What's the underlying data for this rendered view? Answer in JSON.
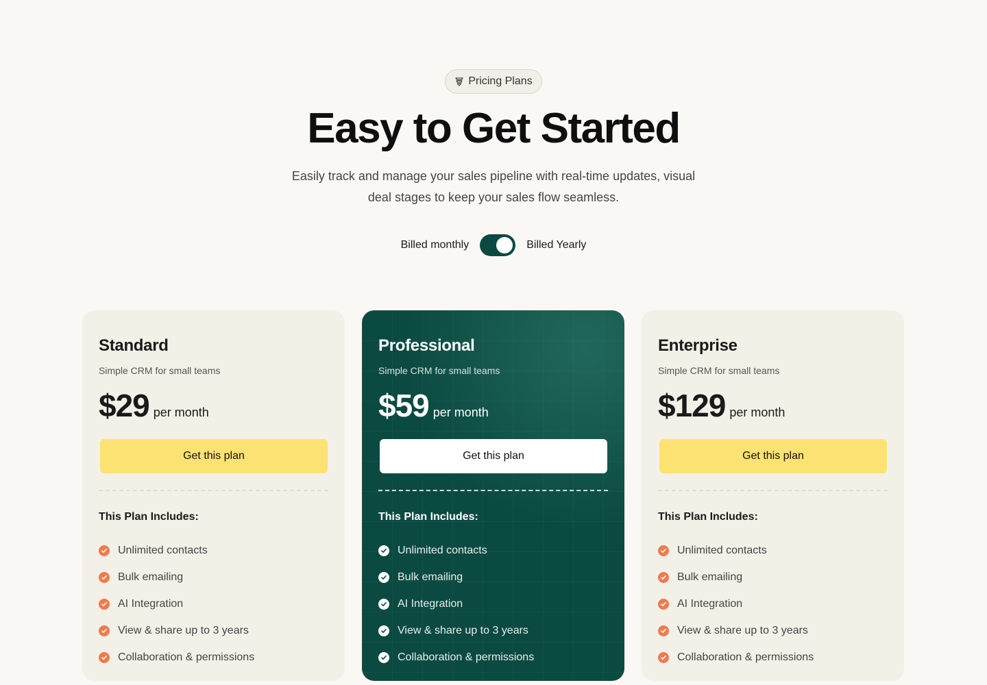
{
  "header": {
    "badge": "Pricing Plans",
    "title": "Easy to Get Started",
    "subtitle": "Easily track and manage your sales pipeline with real-time updates, visual deal stages to keep your sales flow seamless."
  },
  "billing": {
    "monthly_label": "Billed monthly",
    "yearly_label": "Billed Yearly",
    "selected": "yearly"
  },
  "plans": [
    {
      "name": "Standard",
      "description": "Simple CRM for small teams",
      "price": "$29",
      "period": "per month",
      "cta": "Get this plan",
      "includes_title": "This Plan Includes:",
      "features": [
        "Unlimited contacts",
        "Bulk emailing",
        "AI Integration",
        "View & share up to 3 years",
        "Collaboration & permissions"
      ]
    },
    {
      "name": "Professional",
      "description": "Simple CRM for small teams",
      "price": "$59",
      "period": "per month",
      "cta": "Get this plan",
      "includes_title": "This Plan Includes:",
      "features": [
        "Unlimited contacts",
        "Bulk emailing",
        "AI Integration",
        "View & share up to 3 years",
        "Collaboration & permissions"
      ]
    },
    {
      "name": "Enterprise",
      "description": "Simple CRM for small teams",
      "price": "$129",
      "period": "per month",
      "cta": "Get this plan",
      "includes_title": "This Plan Includes:",
      "features": [
        "Unlimited contacts",
        "Bulk emailing",
        "AI Integration",
        "View & share up to 3 years",
        "Collaboration & permissions"
      ]
    }
  ],
  "colors": {
    "background": "#faf8f4",
    "card": "#f3f0e7",
    "featured_card": "#0b4a41",
    "cta_yellow": "#fce272",
    "check_orange": "#f07a4e"
  }
}
